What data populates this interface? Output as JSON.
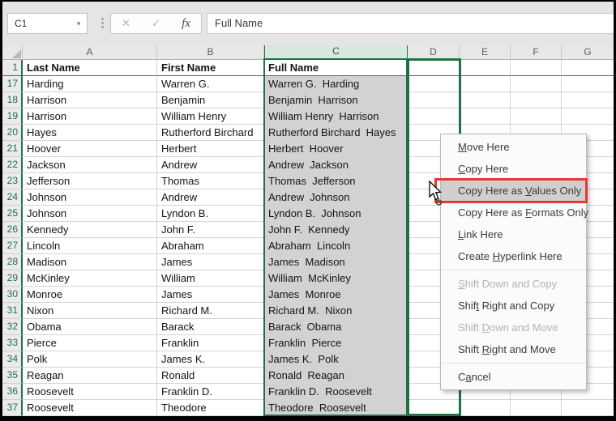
{
  "formula_bar": {
    "name_box_value": "C1",
    "name_box_dropdown_icon": "▾",
    "separator_dots_icon": "⋮",
    "cancel_icon": "✕",
    "enter_icon": "✓",
    "fx_icon": "fx",
    "formula_value": "Full Name"
  },
  "sheet": {
    "columns": [
      "A",
      "B",
      "C",
      "D",
      "E",
      "F",
      "G"
    ],
    "selected_column": "C",
    "rows": [
      {
        "n": "1",
        "a": "Last Name",
        "b": "First Name",
        "c": "Full Name",
        "header": true
      },
      {
        "n": "17",
        "a": "Harding",
        "b": "Warren G.",
        "c": "Warren G.  Harding"
      },
      {
        "n": "18",
        "a": "Harrison",
        "b": "Benjamin",
        "c": "Benjamin  Harrison"
      },
      {
        "n": "19",
        "a": "Harrison",
        "b": "William Henry",
        "c": "William Henry  Harrison"
      },
      {
        "n": "20",
        "a": "Hayes",
        "b": "Rutherford Birchard",
        "c": "Rutherford Birchard  Hayes"
      },
      {
        "n": "21",
        "a": "Hoover",
        "b": "Herbert",
        "c": "Herbert  Hoover"
      },
      {
        "n": "22",
        "a": "Jackson",
        "b": "Andrew",
        "c": "Andrew  Jackson"
      },
      {
        "n": "23",
        "a": "Jefferson",
        "b": "Thomas",
        "c": "Thomas  Jefferson"
      },
      {
        "n": "24",
        "a": "Johnson",
        "b": "Andrew",
        "c": "Andrew  Johnson"
      },
      {
        "n": "25",
        "a": "Johnson",
        "b": "Lyndon B.",
        "c": "Lyndon B.  Johnson"
      },
      {
        "n": "26",
        "a": "Kennedy",
        "b": "John F.",
        "c": "John F.  Kennedy"
      },
      {
        "n": "27",
        "a": "Lincoln",
        "b": "Abraham",
        "c": "Abraham  Lincoln"
      },
      {
        "n": "28",
        "a": "Madison",
        "b": "James",
        "c": "James  Madison"
      },
      {
        "n": "29",
        "a": "McKinley",
        "b": "William",
        "c": "William  McKinley"
      },
      {
        "n": "30",
        "a": "Monroe",
        "b": "James",
        "c": "James  Monroe"
      },
      {
        "n": "31",
        "a": "Nixon",
        "b": "Richard M.",
        "c": "Richard M.  Nixon"
      },
      {
        "n": "32",
        "a": "Obama",
        "b": "Barack",
        "c": "Barack  Obama"
      },
      {
        "n": "33",
        "a": "Pierce",
        "b": "Franklin",
        "c": "Franklin  Pierce"
      },
      {
        "n": "34",
        "a": "Polk",
        "b": "James K.",
        "c": "James K.  Polk"
      },
      {
        "n": "35",
        "a": "Reagan",
        "b": "Ronald",
        "c": "Ronald  Reagan"
      },
      {
        "n": "36",
        "a": "Roosevelt",
        "b": "Franklin D.",
        "c": "Franklin D.  Roosevelt"
      },
      {
        "n": "37",
        "a": "Roosevelt",
        "b": "Theodore",
        "c": "Theodore  Roosevelt"
      }
    ]
  },
  "context_menu": {
    "items": [
      {
        "label": "Move Here",
        "pre": "",
        "accel": "M",
        "post": "ove Here",
        "state": "normal"
      },
      {
        "label": "Copy Here",
        "pre": "",
        "accel": "C",
        "post": "opy Here",
        "state": "normal"
      },
      {
        "label": "Copy Here as Values Only",
        "pre": "Copy Here as ",
        "accel": "V",
        "post": "alues Only",
        "state": "highlighted"
      },
      {
        "label": "Copy Here as Formats Only",
        "pre": "Copy Here as ",
        "accel": "F",
        "post": "ormats Only",
        "state": "normal"
      },
      {
        "label": "Link Here",
        "pre": "",
        "accel": "L",
        "post": "ink Here",
        "state": "normal"
      },
      {
        "label": "Create Hyperlink Here",
        "pre": "Create ",
        "accel": "H",
        "post": "yperlink Here",
        "state": "normal"
      },
      {
        "separator": true
      },
      {
        "label": "Shift Down and Copy",
        "pre": "",
        "accel": "S",
        "post": "hift Down and Copy",
        "state": "disabled"
      },
      {
        "label": "Shift Right and Copy",
        "pre": "Shif",
        "accel": "t",
        "post": " Right and Copy",
        "state": "normal"
      },
      {
        "label": "Shift Down and Move",
        "pre": "Shift ",
        "accel": "D",
        "post": "own and Move",
        "state": "disabled"
      },
      {
        "label": "Shift Right and Move",
        "pre": "Shift ",
        "accel": "R",
        "post": "ight and Move",
        "state": "normal"
      },
      {
        "separator": true
      },
      {
        "label": "Cancel",
        "pre": "C",
        "accel": "a",
        "post": "ncel",
        "state": "normal"
      }
    ]
  },
  "colors": {
    "selection_green": "#1f7246",
    "selected_header_fill": "#d9e8de",
    "selected_cells_gray": "#d2d2d2",
    "annotation_red": "#e8392f",
    "menu_highlight_gray": "#d0cfcf"
  }
}
